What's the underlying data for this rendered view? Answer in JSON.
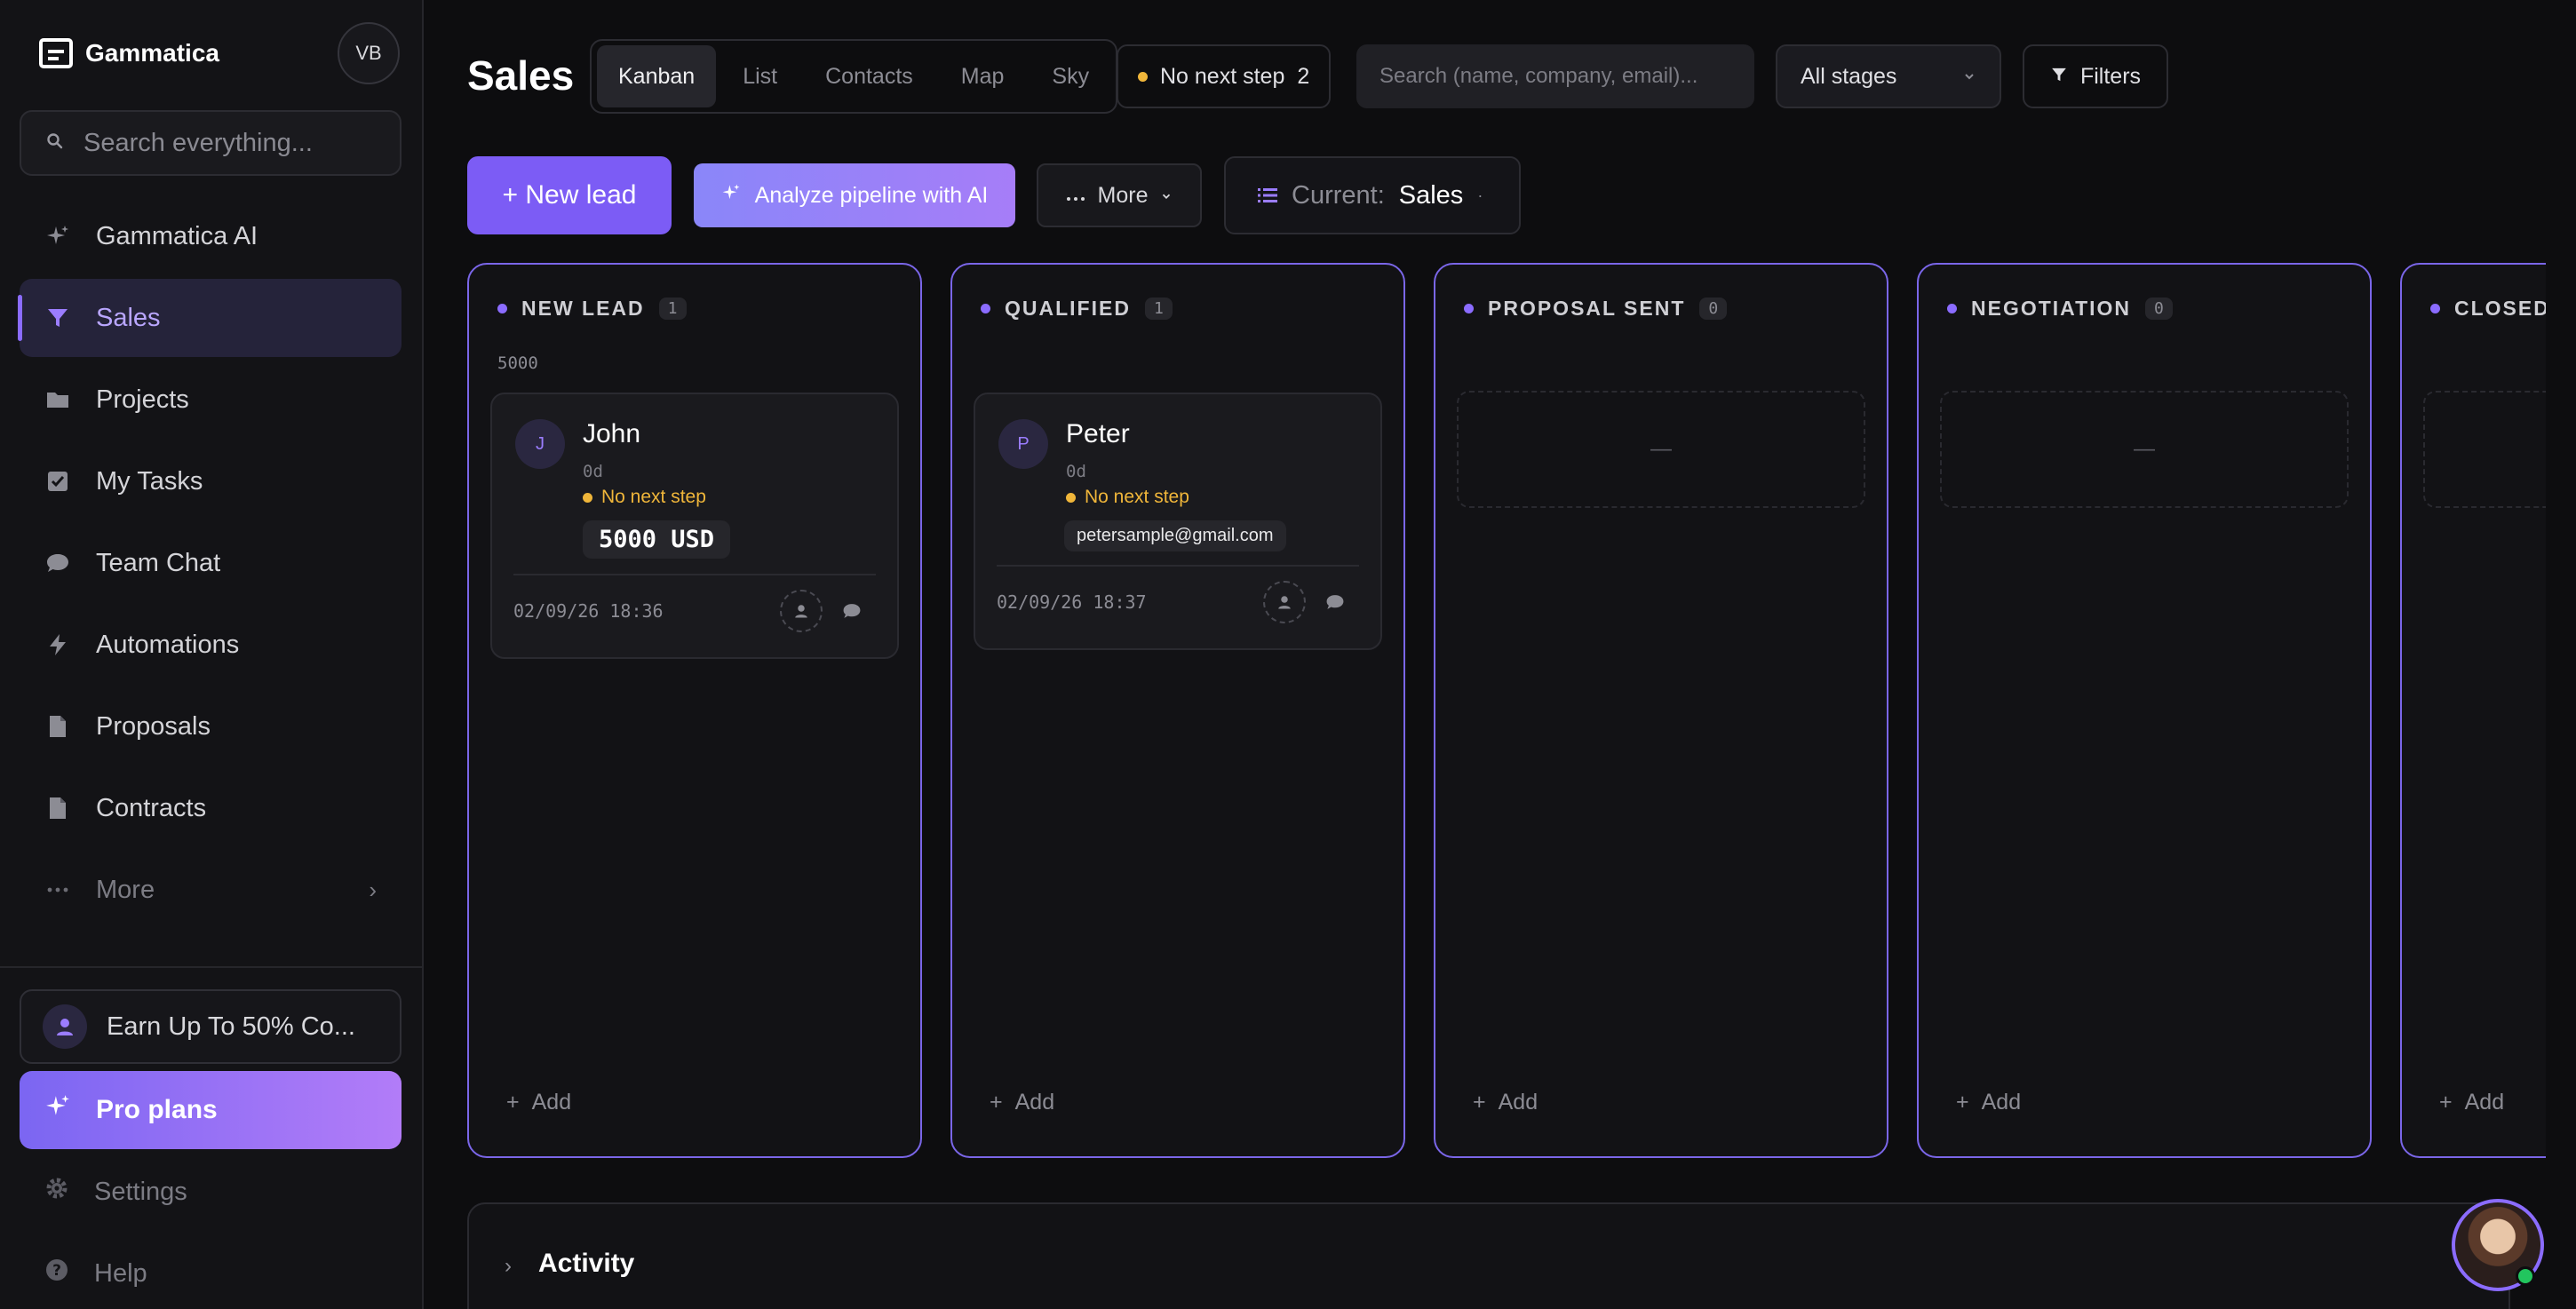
{
  "sidebar": {
    "brand": "Gammatica",
    "user_initials": "VB",
    "search_placeholder": "Search everything...",
    "items": [
      {
        "label": "Gammatica AI",
        "icon": "sparkle-icon",
        "active": false
      },
      {
        "label": "Sales",
        "icon": "funnel-icon",
        "active": true
      },
      {
        "label": "Projects",
        "icon": "folder-icon",
        "active": false
      },
      {
        "label": "My Tasks",
        "icon": "check-square-icon",
        "active": false
      },
      {
        "label": "Team Chat",
        "icon": "chat-icon",
        "active": false
      },
      {
        "label": "Automations",
        "icon": "bolt-icon",
        "active": false
      },
      {
        "label": "Proposals",
        "icon": "document-icon",
        "active": false
      },
      {
        "label": "Contracts",
        "icon": "document-icon",
        "active": false
      },
      {
        "label": "More",
        "icon": "ellipsis-icon",
        "active": false
      }
    ],
    "earn_label": "Earn Up To 50% Co...",
    "pro_label": "Pro plans",
    "settings_label": "Settings",
    "help_label": "Help"
  },
  "header": {
    "title": "Sales",
    "tabs": [
      "Kanban",
      "List",
      "Contacts",
      "Map",
      "Sky"
    ],
    "active_tab": "Kanban",
    "no_next_step_label": "No next step",
    "no_next_step_count": "2",
    "search_placeholder": "Search (name, company, email)...",
    "stage_filter": "All stages",
    "filters_label": "Filters"
  },
  "toolbar": {
    "new_lead_label": "+ New lead",
    "analyze_label": "Analyze pipeline with AI",
    "more_label": "More",
    "current_label": "Current:",
    "current_value": "Sales"
  },
  "board": {
    "columns": [
      {
        "name": "NEW LEAD",
        "count": "1",
        "sum": "5000",
        "add_label": "Add"
      },
      {
        "name": "QUALIFIED",
        "count": "1",
        "sum": "",
        "add_label": "Add"
      },
      {
        "name": "PROPOSAL SENT",
        "count": "0",
        "empty": "—",
        "add_label": "Add"
      },
      {
        "name": "NEGOTIATION",
        "count": "0",
        "empty": "—",
        "add_label": "Add"
      },
      {
        "name": "CLOSED",
        "count": "",
        "empty": "",
        "add_label": "Add"
      }
    ],
    "cards": [
      {
        "initial": "J",
        "name": "John",
        "age": "0d",
        "next_step": "No next step",
        "value": "5000 USD",
        "date": "02/09/26 18:36"
      },
      {
        "initial": "P",
        "name": "Peter",
        "age": "0d",
        "next_step": "No next step",
        "email": "petersample@gmail.com",
        "date": "02/09/26 18:37"
      }
    ]
  },
  "activity": {
    "label": "Activity"
  },
  "colors": {
    "accent": "#7c5cf5",
    "column_border": "#7a66e8",
    "warning": "#f0b63a",
    "online": "#22c55e"
  }
}
